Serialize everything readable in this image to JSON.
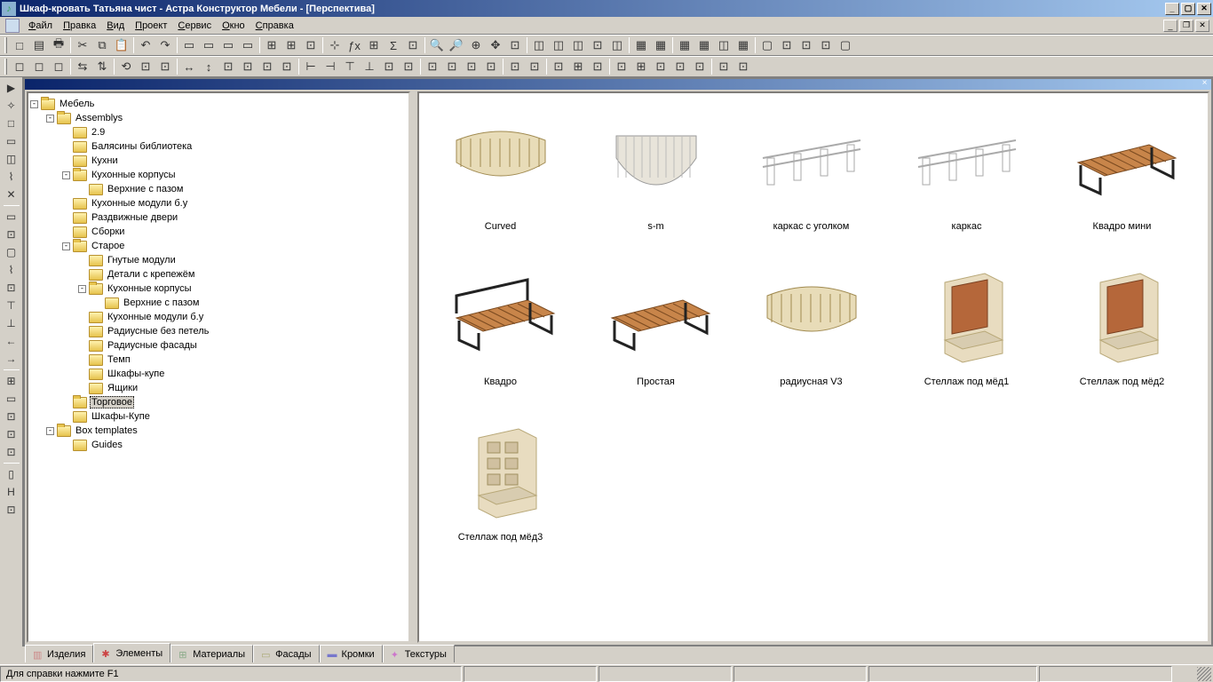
{
  "title": "Шкаф-кровать Татьяна чист - Астра Конструктор Мебели - [Перспектива]",
  "menu": [
    "Файл",
    "Правка",
    "Вид",
    "Проект",
    "Сервис",
    "Окно",
    "Справка"
  ],
  "tree": {
    "root": "Мебель",
    "items": [
      {
        "d": 1,
        "exp": "-",
        "label": "Assemblys",
        "open": true
      },
      {
        "d": 2,
        "exp": "",
        "label": "2.9"
      },
      {
        "d": 2,
        "exp": "",
        "label": "Балясины библиотека"
      },
      {
        "d": 2,
        "exp": "",
        "label": "Кухни"
      },
      {
        "d": 2,
        "exp": "-",
        "label": "Кухонные корпусы",
        "open": true
      },
      {
        "d": 3,
        "exp": "",
        "label": "Верхние с пазом"
      },
      {
        "d": 2,
        "exp": "",
        "label": "Кухонные модули б.у"
      },
      {
        "d": 2,
        "exp": "",
        "label": "Раздвижные двери"
      },
      {
        "d": 2,
        "exp": "",
        "label": "Сборки"
      },
      {
        "d": 2,
        "exp": "-",
        "label": "Старое",
        "open": true
      },
      {
        "d": 3,
        "exp": "",
        "label": "Гнутые модули"
      },
      {
        "d": 3,
        "exp": "",
        "label": "Детали с крепежём"
      },
      {
        "d": 3,
        "exp": "-",
        "label": "Кухонные корпусы",
        "open": true
      },
      {
        "d": 4,
        "exp": "",
        "label": "Верхние с пазом"
      },
      {
        "d": 3,
        "exp": "",
        "label": "Кухонные модули б.у"
      },
      {
        "d": 3,
        "exp": "",
        "label": "Радиусные без петель"
      },
      {
        "d": 3,
        "exp": "",
        "label": "Радиусные фасады"
      },
      {
        "d": 3,
        "exp": "",
        "label": "Темп"
      },
      {
        "d": 3,
        "exp": "",
        "label": "Шкафы-купе"
      },
      {
        "d": 3,
        "exp": "",
        "label": "Ящики"
      },
      {
        "d": 2,
        "exp": "",
        "label": "Торговое",
        "sel": true,
        "open": true
      },
      {
        "d": 2,
        "exp": "",
        "label": "Шкафы-Купе"
      },
      {
        "d": 1,
        "exp": "-",
        "label": "Box templates",
        "open": true
      },
      {
        "d": 2,
        "exp": "",
        "label": "Guides"
      }
    ]
  },
  "thumbs": [
    {
      "name": "Curved",
      "kind": "curved"
    },
    {
      "name": "s-m",
      "kind": "sm"
    },
    {
      "name": "каркас с уголком",
      "kind": "frame-corner"
    },
    {
      "name": "каркас",
      "kind": "frame"
    },
    {
      "name": "Квадро мини",
      "kind": "bench-mini"
    },
    {
      "name": "Квадро",
      "kind": "bench"
    },
    {
      "name": "Простая",
      "kind": "bench-simple"
    },
    {
      "name": "радиусная V3",
      "kind": "radial"
    },
    {
      "name": "Стеллаж под мёд1",
      "kind": "shelf1"
    },
    {
      "name": "Стеллаж под мёд2",
      "kind": "shelf2"
    },
    {
      "name": "Стеллаж под мёд3",
      "kind": "shelf3"
    }
  ],
  "bottom_tabs": [
    "Изделия",
    "Элементы",
    "Материалы",
    "Фасады",
    "Кромки",
    "Текстуры"
  ],
  "status": "Для справки нажмите F1",
  "toolbar_icons_row1": [
    "□",
    "▤",
    "🖶",
    "",
    "✂",
    "⧉",
    "📋",
    "",
    "↶",
    "↷",
    "",
    "▭",
    "▭",
    "▭",
    "▭",
    "",
    "⊞",
    "⊞",
    "⊡",
    "",
    "⊹",
    "ƒx",
    "⊞",
    "Σ",
    "⊡",
    "",
    "🔍",
    "🔎",
    "⊕",
    "✥",
    "⊡",
    "",
    "◫",
    "◫",
    "◫",
    "⊡",
    "◫",
    "",
    "▦",
    "▦",
    "",
    "▦",
    "▦",
    "◫",
    "▦",
    "",
    "▢",
    "⊡",
    "⊡",
    "⊡",
    "▢"
  ],
  "toolbar_icons_row2": [
    "◻",
    "◻",
    "◻",
    "",
    "⇆",
    "⇅",
    "",
    "⟲",
    "⊡",
    "⊡",
    "",
    "↔",
    "↕",
    "⊡",
    "⊡",
    "⊡",
    "⊡",
    "",
    "⊢",
    "⊣",
    "⊤",
    "⊥",
    "⊡",
    "⊡",
    "",
    "⊡",
    "⊡",
    "⊡",
    "⊡",
    "",
    "⊡",
    "⊡",
    "",
    "⊡",
    "⊞",
    "⊡",
    "",
    "⊡",
    "⊞",
    "⊡",
    "⊡",
    "⊡",
    "",
    "⊡",
    "⊡"
  ],
  "left_icons": [
    "▶",
    "✧",
    "□",
    "▭",
    "◫",
    "⌇",
    "✕",
    "",
    "▭",
    "⊡",
    "▢",
    "⌇",
    "⊡",
    "⊤",
    "⊥",
    "←",
    "→",
    "",
    "⊞",
    "▭",
    "⊡",
    "⊡",
    "⊡",
    "",
    "▯",
    "H",
    "⊡"
  ]
}
